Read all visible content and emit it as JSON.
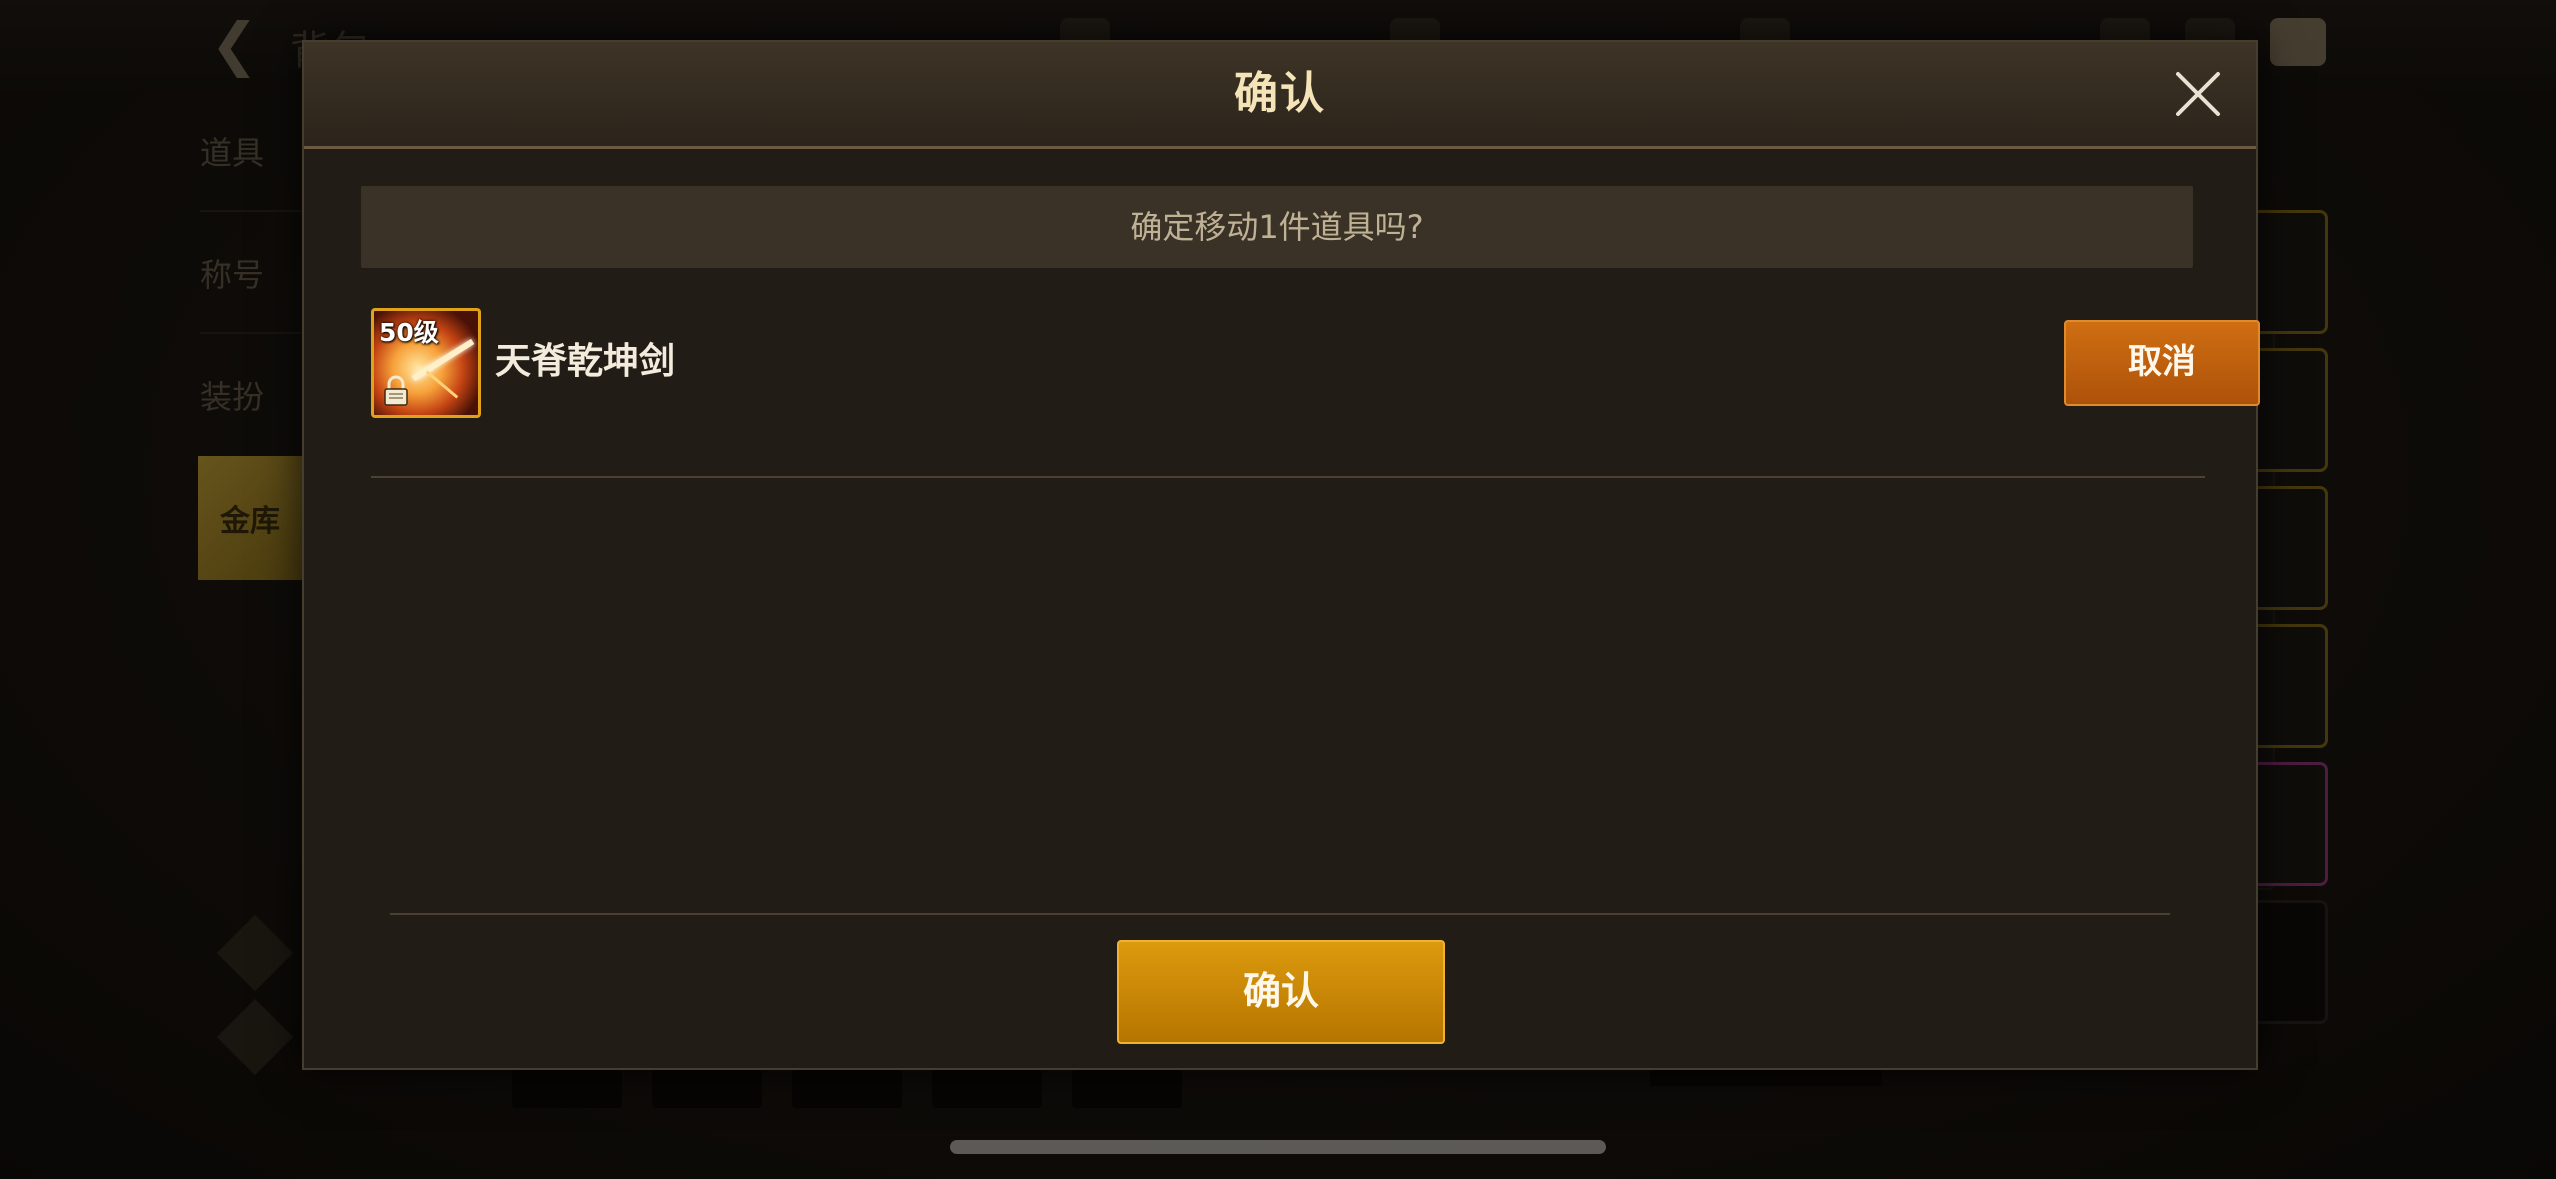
{
  "background": {
    "title": "背包",
    "sidebar_items": [
      "道具",
      "称号",
      "装扮"
    ],
    "active_sidebar": "金库"
  },
  "dialog": {
    "title": "确认",
    "prompt": "确定移动1件道具吗?",
    "item": {
      "level_label": "50级",
      "name": "天脊乾坤剑",
      "locked": true,
      "frame_color": "#e0a21a"
    },
    "cancel_label": "取消",
    "confirm_label": "确认"
  },
  "icons": {
    "close": "close-icon",
    "lock": "lock-icon",
    "back": "back-arrow-icon"
  },
  "colors": {
    "cancel_button": "#c0600e",
    "confirm_button": "#c98a08",
    "title_text": "#f4e4b8"
  }
}
